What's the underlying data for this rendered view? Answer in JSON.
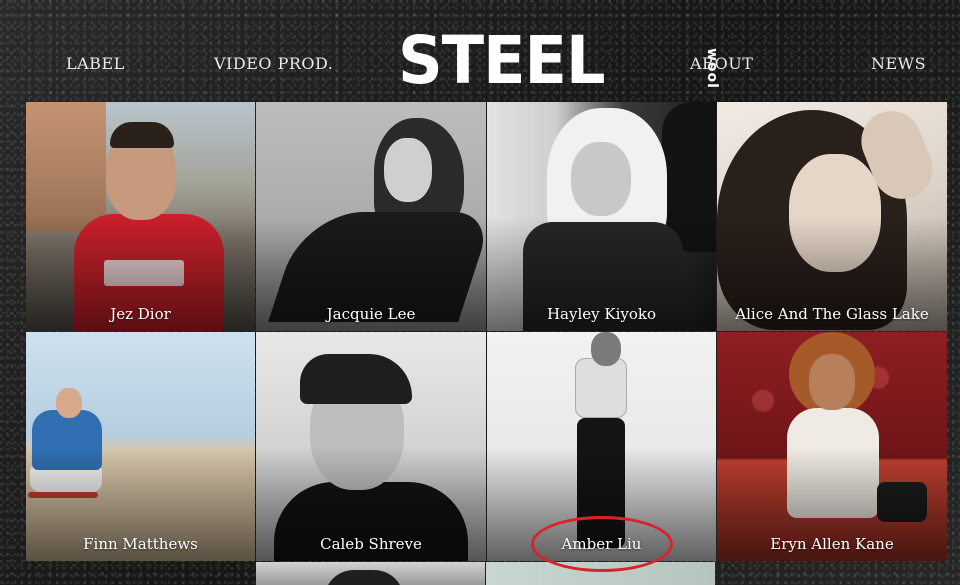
{
  "nav": {
    "left": [
      "LABEL",
      "VIDEO PROD."
    ],
    "right": [
      "ABOUT",
      "NEWS"
    ]
  },
  "logo": {
    "main": "STEEL",
    "sub": "wool"
  },
  "artists": [
    {
      "name": "Jez Dior"
    },
    {
      "name": "Jacquie Lee"
    },
    {
      "name": "Hayley Kiyoko"
    },
    {
      "name": "Alice And The Glass Lake"
    },
    {
      "name": "Finn Matthews"
    },
    {
      "name": "Caleb Shreve"
    },
    {
      "name": "Amber Liu"
    },
    {
      "name": "Eryn Allen Kane"
    }
  ],
  "colors": {
    "highlight_ring": "#d8232a",
    "text": "#ffffff"
  }
}
